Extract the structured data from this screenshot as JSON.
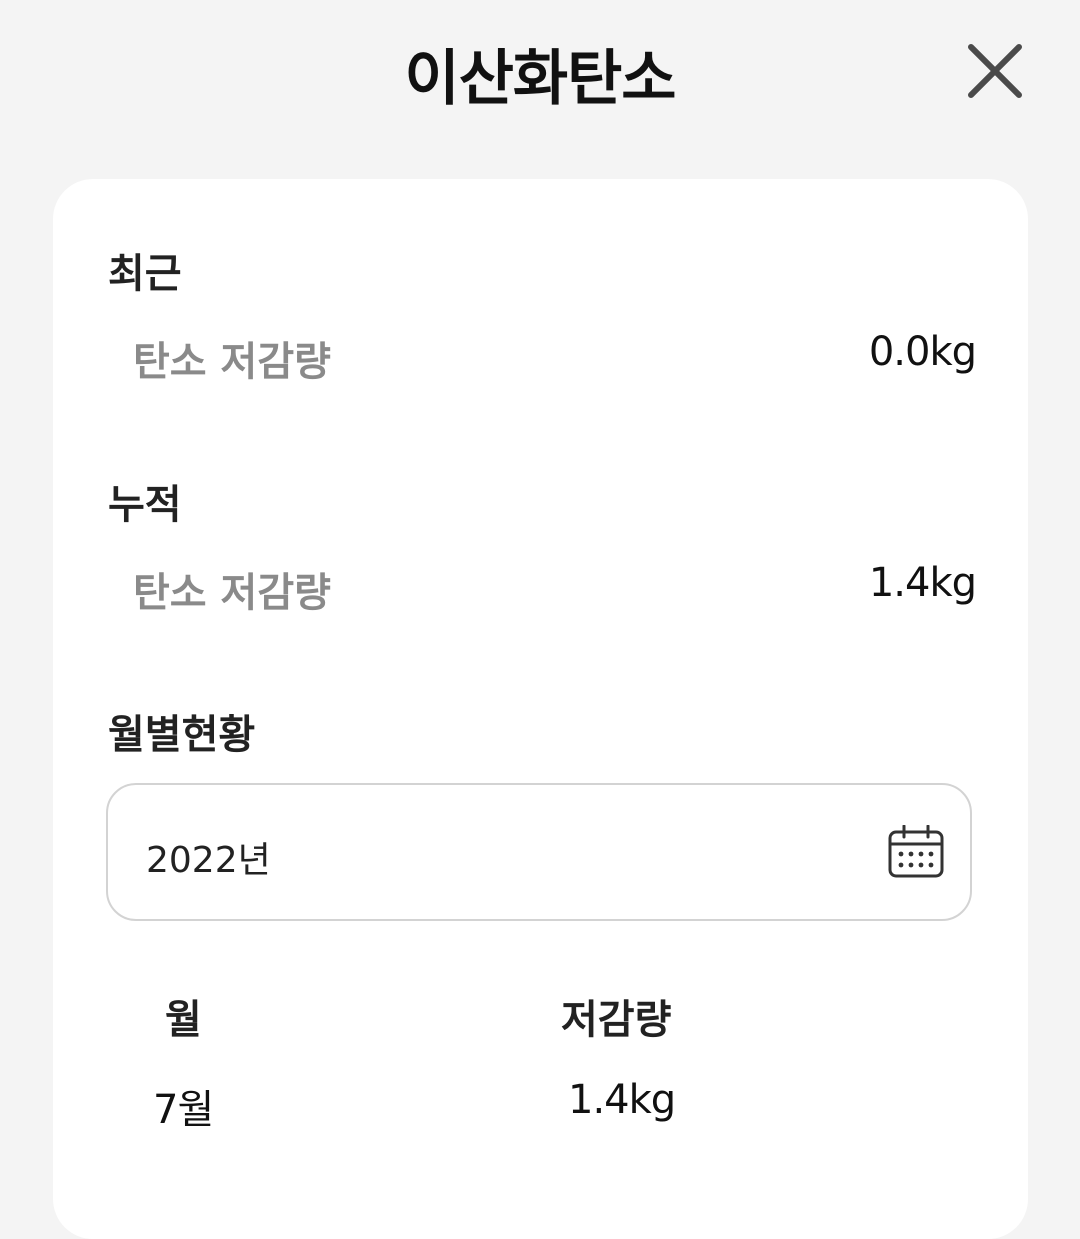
{
  "header": {
    "title": "이산화탄소",
    "close_icon": "close-icon"
  },
  "recent": {
    "section_label": "최근",
    "row_label": "탄소 저감량",
    "value": "0.0kg"
  },
  "cumulative": {
    "section_label": "누적",
    "row_label": "탄소 저감량",
    "value": "1.4kg"
  },
  "monthly": {
    "section_label": "월별현황",
    "year_value": "2022년",
    "calendar_icon": "calendar-icon",
    "columns": [
      "월",
      "저감량"
    ],
    "rows": [
      {
        "month": "7월",
        "amount": "1.4kg"
      }
    ]
  },
  "colors": {
    "background": "#f4f4f4",
    "card": "#ffffff",
    "muted_text": "#8a8a8a",
    "border": "#d3d3d3"
  }
}
